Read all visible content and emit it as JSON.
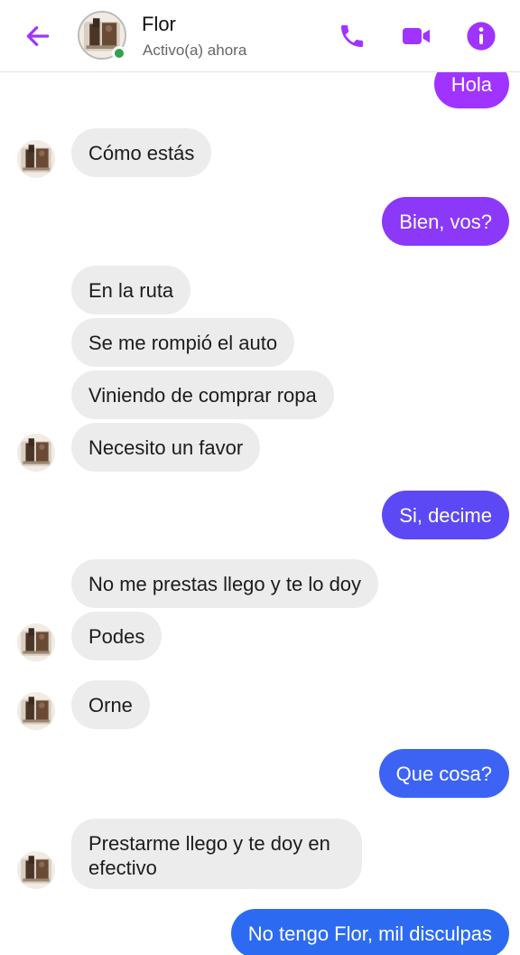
{
  "header": {
    "name": "Flor",
    "status": "Activo(a) ahora",
    "accent_color": "#a033ff",
    "icons": [
      "back-arrow-icon",
      "phone-icon",
      "video-camera-icon",
      "info-icon"
    ]
  },
  "colors": {
    "incoming_bubble": "#ececec",
    "outgoing_gradient": [
      "#a033ff",
      "#6a3ef5",
      "#3e5bf5",
      "#2c6bf1"
    ]
  },
  "messages": [
    {
      "from": "me",
      "text": "Hola"
    },
    {
      "from": "them",
      "text": "Cómo estás"
    },
    {
      "from": "me",
      "text": "Bien, vos?"
    },
    {
      "from": "them",
      "text": "En la ruta"
    },
    {
      "from": "them",
      "text": "Se me rompió el auto"
    },
    {
      "from": "them",
      "text": "Viniendo de comprar ropa"
    },
    {
      "from": "them",
      "text": "Necesito un favor"
    },
    {
      "from": "me",
      "text": "Si, decime"
    },
    {
      "from": "them",
      "text": "No me prestas llego y te lo doy"
    },
    {
      "from": "them",
      "text": "Podes"
    },
    {
      "from": "them",
      "text": "Orne"
    },
    {
      "from": "me",
      "text": "Que cosa?"
    },
    {
      "from": "them",
      "text": "Prestarme llego y te doy en efectivo"
    },
    {
      "from": "me",
      "text": "No tengo Flor, mil disculpas"
    }
  ]
}
